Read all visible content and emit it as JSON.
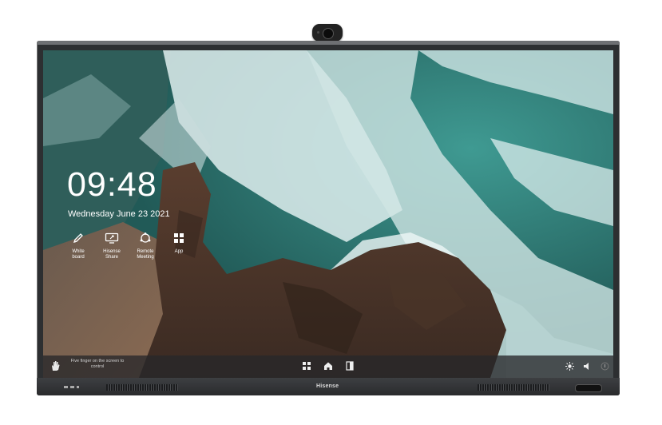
{
  "clock": {
    "time": "09:48",
    "date": "Wednesday June 23 2021"
  },
  "apps": [
    {
      "icon": "pen-icon",
      "label": "White board"
    },
    {
      "icon": "screen-share-icon",
      "label": "Hisense Share"
    },
    {
      "icon": "meeting-icon",
      "label": "Remote Meeting"
    },
    {
      "icon": "apps-grid-icon",
      "label": "App"
    }
  ],
  "taskbar": {
    "hint": "Five finger on the screen to control",
    "nav_icons": [
      "apps-grid-icon",
      "home-icon",
      "sidebar-icon"
    ],
    "right_icons": [
      "brightness-icon",
      "volume-icon",
      "info-icon"
    ]
  },
  "hardware": {
    "brand": "Hisense"
  }
}
